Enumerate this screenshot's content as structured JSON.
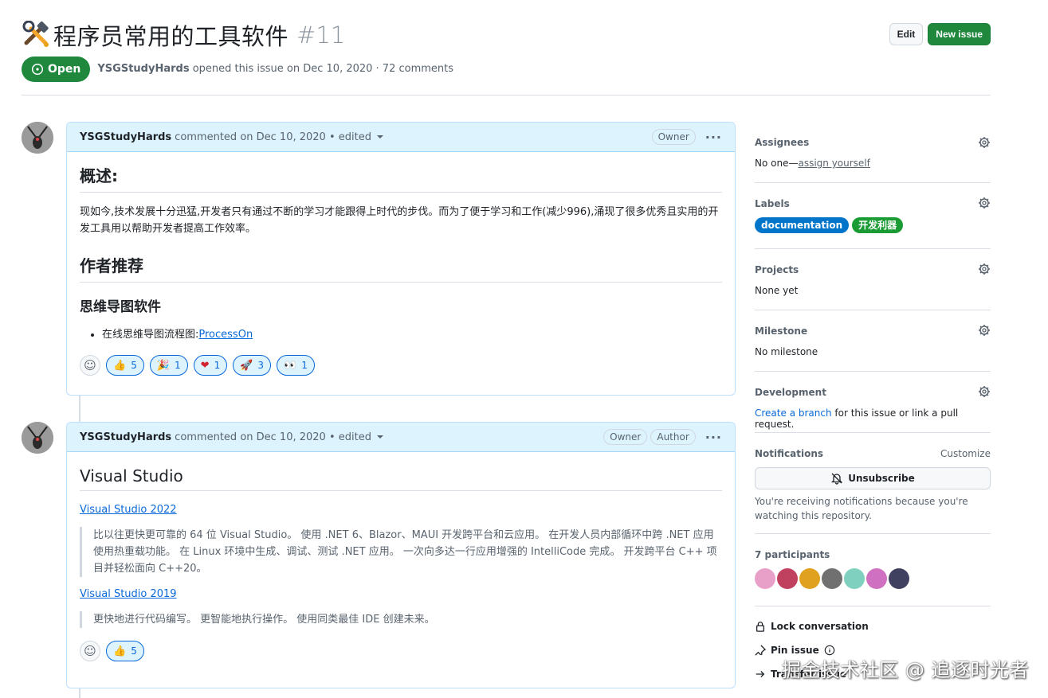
{
  "issue": {
    "title": "程序员常用的工具软件",
    "number": "#11",
    "state": "Open",
    "author": "YSGStudyHards",
    "meta_suffix": "opened this issue on Dec 10, 2020 · 72 comments"
  },
  "header_actions": {
    "edit_label": "Edit",
    "new_issue_label": "New issue"
  },
  "comments": [
    {
      "author": "YSGStudyHards",
      "meta": "commented on Dec 10, 2020 • edited",
      "badges": [
        "Owner"
      ],
      "h1_overview": "概述:",
      "overview_text": "现如今,技术发展十分迅猛,开发者只有通过不断的学习才能跟得上时代的步伐。而为了便于学习和工作(减少996),涌现了很多优秀且实用的开发工具用以帮助开发者提高工作效率。",
      "h1_recommend": "作者推荐",
      "h3_mindmap": "思维导图软件",
      "list_item_prefix": "在线思维导图流程图:",
      "list_item_link": "ProcessOn",
      "reactions": [
        {
          "emoji": "👍",
          "count": "5"
        },
        {
          "emoji": "🎉",
          "count": "1"
        },
        {
          "emoji": "❤",
          "count": "1"
        },
        {
          "emoji": "🚀",
          "count": "3"
        },
        {
          "emoji": "👀",
          "count": "1"
        }
      ]
    },
    {
      "author": "YSGStudyHards",
      "meta": "commented on Dec 10, 2020 • edited",
      "badges": [
        "Owner",
        "Author"
      ],
      "h1": "Visual Studio",
      "link1": "Visual Studio 2022",
      "quote1": "比以往更快更可靠的 64 位 Visual Studio。 使用 .NET 6、Blazor、MAUI 开发跨平台和云应用。 在开发人员内部循环中跨 .NET 应用使用热重载功能。 在 Linux 环境中生成、调试、测试 .NET 应用。 一次向多达一行应用增强的 IntelliCode 完成。 开发跨平台 C++ 项目并轻松面向 C++20。",
      "link2": "Visual Studio 2019",
      "quote2": "更快地进行代码编写。 更智能地执行操作。 使用同类最佳 IDE 创建未来。",
      "reactions": [
        {
          "emoji": "👍",
          "count": "5"
        }
      ]
    }
  ],
  "sidebar": {
    "assignees": {
      "title": "Assignees",
      "value_prefix": "No one—",
      "value_link": "assign yourself"
    },
    "labels": {
      "title": "Labels",
      "items": [
        {
          "name": "documentation",
          "color": "#0075ca"
        },
        {
          "name": "开发利器",
          "color": "#1a9b33"
        }
      ]
    },
    "projects": {
      "title": "Projects",
      "value": "None yet"
    },
    "milestone": {
      "title": "Milestone",
      "value": "No milestone"
    },
    "development": {
      "title": "Development",
      "link": "Create a branch",
      "suffix": " for this issue or link a pull request."
    },
    "notifications": {
      "title": "Notifications",
      "customize": "Customize",
      "button": "Unsubscribe",
      "note": "You're receiving notifications because you're watching this repository."
    },
    "participants": {
      "title": "7 participants",
      "colors": [
        "#e8a0c8",
        "#c04060",
        "#e0a020",
        "#707070",
        "#80d0c0",
        "#d070c0",
        "#404060"
      ]
    },
    "actions": {
      "lock": "Lock conversation",
      "pin": "Pin issue",
      "transfer": "Transfer issue"
    }
  },
  "watermark": "掘金技术社区 @ 追逐时光者"
}
